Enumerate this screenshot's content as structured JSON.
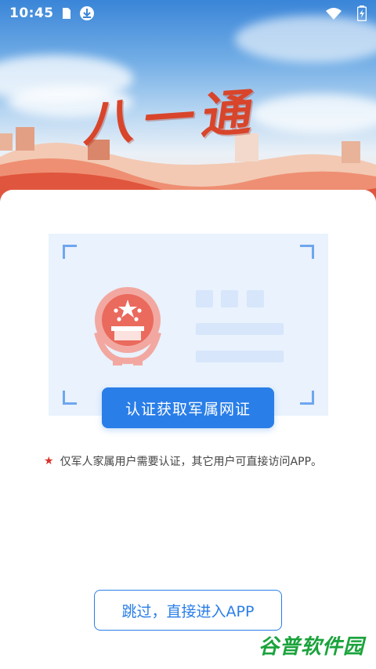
{
  "status_bar": {
    "time": "10:45",
    "icons": [
      "sim-card-icon",
      "download-notification-icon",
      "wifi-icon",
      "battery-charging-icon"
    ]
  },
  "banner": {
    "app_title": "八一通"
  },
  "card": {
    "auth_button_label": "认证获取军属网证",
    "notice_text": "仅军人家属用户需要认证，其它用户可直接访问APP。",
    "skip_button_label": "跳过，直接进入APP"
  },
  "watermark": {
    "text": "谷普软件园"
  },
  "colors": {
    "primary": "#2a7ee8",
    "accent_red": "#d9312b",
    "placeholder": "#d7e6fa"
  }
}
